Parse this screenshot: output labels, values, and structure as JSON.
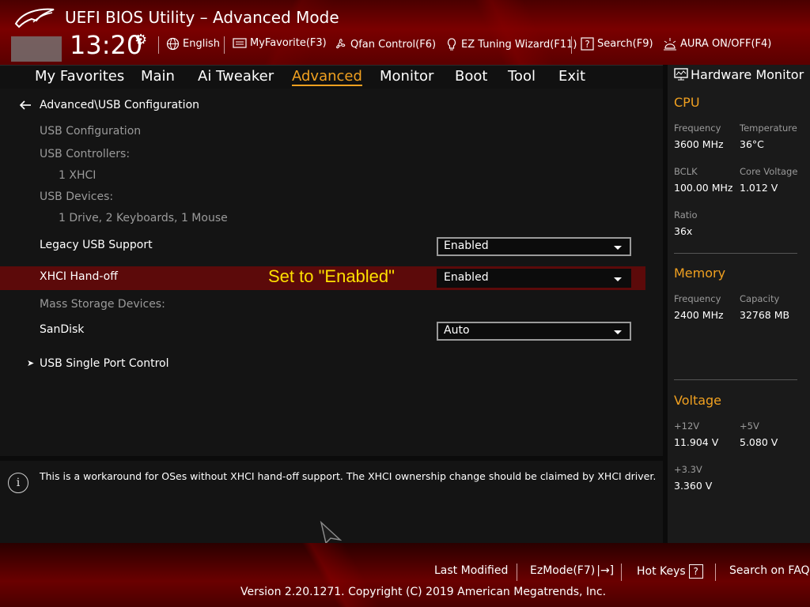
{
  "header": {
    "title": "UEFI BIOS Utility – Advanced Mode",
    "time": "13:20",
    "items": {
      "language": "English",
      "myfavorite": "MyFavorite(F3)",
      "qfan": "Qfan Control(F6)",
      "ez_tuning": "EZ Tuning Wizard(F11)",
      "search": "Search(F9)",
      "aura": "AURA ON/OFF(F4)"
    }
  },
  "menu": {
    "tabs": [
      "My Favorites",
      "Main",
      "Ai Tweaker",
      "Advanced",
      "Monitor",
      "Boot",
      "Tool",
      "Exit"
    ],
    "active": "Advanced"
  },
  "main": {
    "breadcrumb": "Advanced\\USB Configuration",
    "usb_config_label": "USB Configuration",
    "usb_controllers_label": "USB Controllers:",
    "usb_controllers_value": "1 XHCI",
    "usb_devices_label": "USB Devices:",
    "usb_devices_value": "1 Drive, 2 Keyboards, 1 Mouse",
    "legacy_usb": {
      "label": "Legacy USB Support",
      "value": "Enabled"
    },
    "xhci_handoff": {
      "label": "XHCI Hand-off",
      "value": "Enabled"
    },
    "annotation": "Set to \"Enabled\"",
    "mass_storage_label": "Mass Storage Devices:",
    "sandisk": {
      "label": "SanDisk",
      "value": "Auto"
    },
    "single_port": "USB Single Port Control"
  },
  "help": {
    "text": "This is a workaround for OSes without XHCI hand-off support. The XHCI ownership change should be claimed by XHCI driver."
  },
  "hardware_monitor": {
    "title": "Hardware Monitor",
    "cpu": {
      "title": "CPU",
      "frequency_label": "Frequency",
      "frequency": "3600 MHz",
      "temperature_label": "Temperature",
      "temperature": "36°C",
      "bclk_label": "BCLK",
      "bclk": "100.00 MHz",
      "core_voltage_label": "Core Voltage",
      "core_voltage": "1.012 V",
      "ratio_label": "Ratio",
      "ratio": "36x"
    },
    "memory": {
      "title": "Memory",
      "frequency_label": "Frequency",
      "frequency": "2400 MHz",
      "capacity_label": "Capacity",
      "capacity": "32768 MB"
    },
    "voltage": {
      "title": "Voltage",
      "v12_label": "+12V",
      "v12": "11.904 V",
      "v5_label": "+5V",
      "v5": "5.080 V",
      "v33_label": "+3.3V",
      "v33": "3.360 V"
    }
  },
  "footer": {
    "last_modified": "Last Modified",
    "ezmode": "EzMode(F7)",
    "hotkeys": "Hot Keys",
    "search_faq": "Search on FAQ",
    "version": "Version 2.20.1271. Copyright (C) 2019 American Megatrends, Inc."
  },
  "colors": {
    "accent": "#f0a020",
    "highlight_row": "#5c0a0a",
    "annotation": "#ffe000"
  }
}
